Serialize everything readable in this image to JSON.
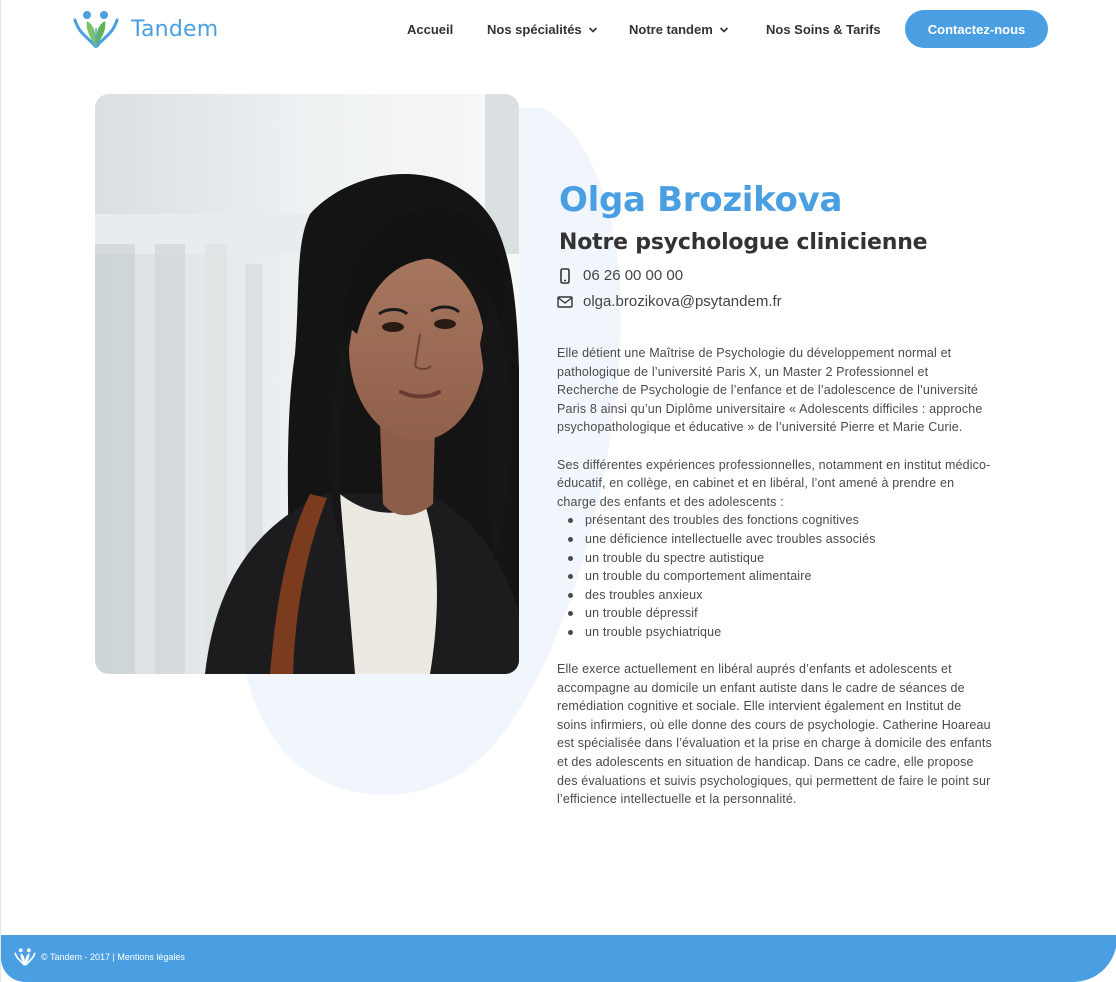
{
  "brand": {
    "name": "Tandem",
    "color": "#4a9fe2"
  },
  "nav": {
    "accueil": "Accueil",
    "specialites": "Nos spécialités",
    "tandem": "Notre tandem",
    "soins": "Nos Soins & Tarifs",
    "contact": "Contactez-nous"
  },
  "profile": {
    "name": "Olga Brozikova",
    "role": "Notre psychologue clinicienne",
    "phone": "06 26 00 00  00",
    "email": "olga.brozikova@psytandem.fr",
    "bio_p1": "Elle détient une Maîtrise de Psychologie du développement normal et pathologique de l’université Paris X, un Master 2 Professionnel et Recherche de Psychologie de l’enfance et de l’adolescence de l’université Paris 8 ainsi qu’un Diplôme universitaire « Adolescents difficiles : approche psychopathologique et éducative » de l’université Pierre et Marie Curie.",
    "bio_p2": "Ses différentes expériences professionnelles, notamment en institut médico-éducatif, en collège, en cabinet et en libéral, l’ont amené à prendre en charge des enfants et des adolescents :",
    "bio_list": [
      "présentant des troubles des fonctions cognitives",
      "une déficience intellectuelle avec troubles associés",
      "un trouble du spectre autistique",
      "un trouble du comportement alimentaire",
      "des troubles anxieux",
      "un trouble dépressif",
      "un trouble psychiatrique"
    ],
    "bio_p3": "Elle exerce actuellement en libéral auprés d’enfants et adolescents et accompagne au domicile un enfant autiste dans le cadre de séances de remédiation cognitive et sociale. Elle intervient également en Institut de soins infirmiers, où elle donne des cours de psychologie. Catherine Hoareau est spécialisée dans l’évaluation et la prise en charge à domicile des enfants et des adolescents en situation de handicap. Dans ce cadre, elle propose des évaluations et suivis psychologiques, qui permettent de faire le point sur l’efficience intellectuelle et la personnalité."
  },
  "footer": {
    "text": "© Tandem - 2017 | Mentions légales"
  },
  "icons": {
    "phone": "mobile-phone-icon",
    "email": "envelope-icon",
    "chevron": "chevron-down-icon"
  }
}
